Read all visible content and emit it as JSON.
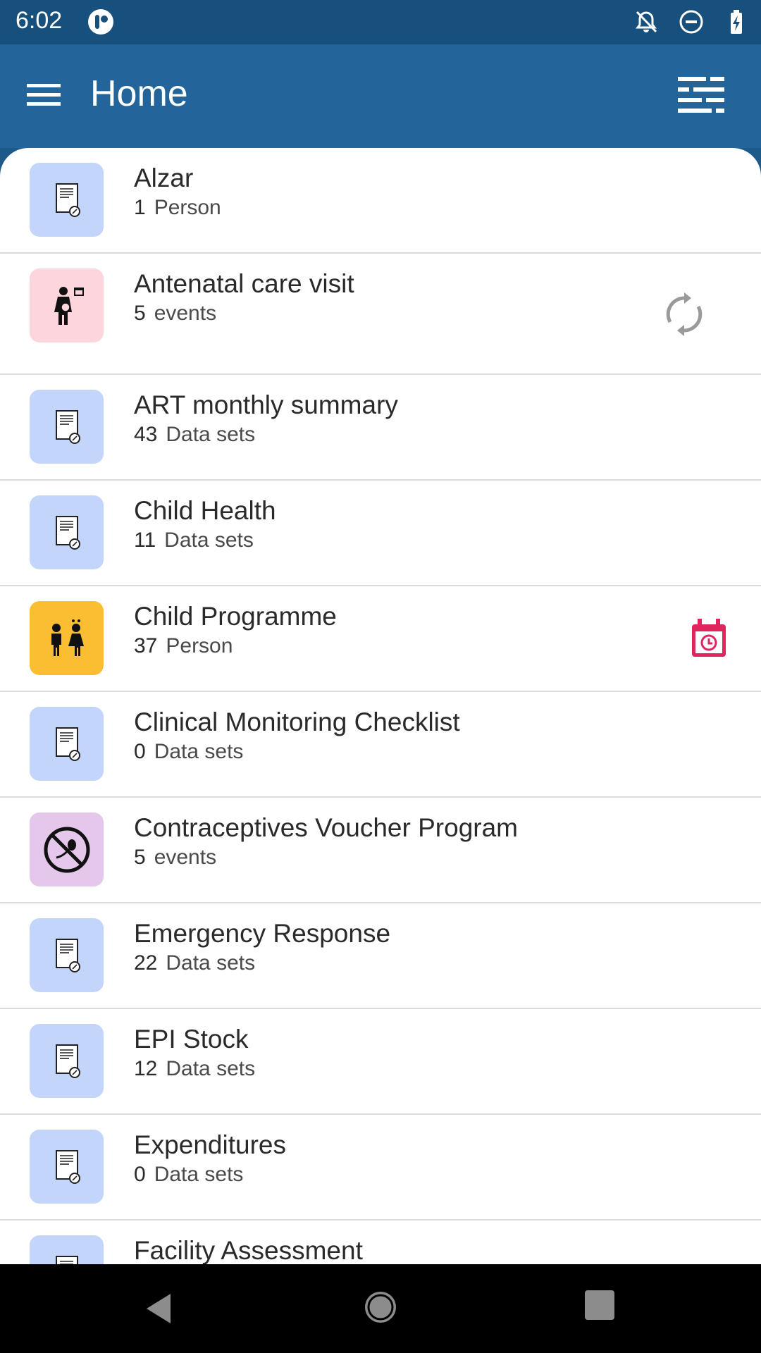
{
  "status_bar": {
    "time": "6:02",
    "icons": [
      "app-notification-icon",
      "notifications-off-icon",
      "do-not-disturb-icon",
      "battery-charging-icon"
    ]
  },
  "app_bar": {
    "title": "Home",
    "left_icon": "menu-icon",
    "right_icon": "filter-icon"
  },
  "colors": {
    "status_bar": "#17507d",
    "app_bar": "#23649a",
    "dataset_icon_bg": "#c4d5fc",
    "antenatal_icon_bg": "#fcd6dc",
    "child_programme_icon_bg": "#fbbd31",
    "contraceptives_icon_bg": "#e4c7ea",
    "calendar_accent": "#e0245e",
    "sync_gray": "#9a9a9a"
  },
  "programs": [
    {
      "name": "Alzar",
      "count": "1",
      "unit": "Person",
      "icon": "dataset-form-icon",
      "status_icon": ""
    },
    {
      "name": "Antenatal care visit",
      "count": "5",
      "unit": "events",
      "icon": "pregnant-woman-icon",
      "status_icon": "sync-icon"
    },
    {
      "name": "ART monthly summary",
      "count": "43",
      "unit": "Data sets",
      "icon": "dataset-form-icon",
      "status_icon": ""
    },
    {
      "name": "Child Health",
      "count": "11",
      "unit": "Data sets",
      "icon": "dataset-form-icon",
      "status_icon": ""
    },
    {
      "name": "Child Programme",
      "count": "37",
      "unit": "Person",
      "icon": "children-icon",
      "status_icon": "calendar-alarm-icon"
    },
    {
      "name": "Clinical Monitoring Checklist",
      "count": "0",
      "unit": "Data sets",
      "icon": "dataset-form-icon",
      "status_icon": ""
    },
    {
      "name": "Contraceptives Voucher Program",
      "count": "5",
      "unit": "events",
      "icon": "no-pregnancy-icon",
      "status_icon": ""
    },
    {
      "name": "Emergency Response",
      "count": "22",
      "unit": "Data sets",
      "icon": "dataset-form-icon",
      "status_icon": ""
    },
    {
      "name": "EPI Stock",
      "count": "12",
      "unit": "Data sets",
      "icon": "dataset-form-icon",
      "status_icon": ""
    },
    {
      "name": "Expenditures",
      "count": "0",
      "unit": "Data sets",
      "icon": "dataset-form-icon",
      "status_icon": ""
    },
    {
      "name": "Facility Assessment",
      "count": "",
      "unit": "",
      "icon": "dataset-form-icon",
      "status_icon": ""
    }
  ],
  "nav_bar": {
    "buttons": [
      "back-icon",
      "home-icon",
      "recents-icon"
    ]
  }
}
